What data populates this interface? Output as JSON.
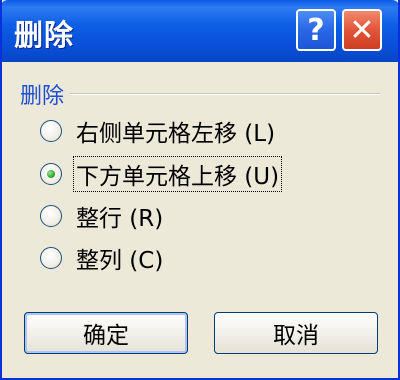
{
  "window": {
    "title": "删除",
    "help_label": "?",
    "close_label": "✕"
  },
  "group": {
    "label": "删除"
  },
  "options": [
    {
      "label": "右侧单元格左移 (L)",
      "selected": false
    },
    {
      "label": "下方单元格上移 (U)",
      "selected": true
    },
    {
      "label": "整行 (R)",
      "selected": false
    },
    {
      "label": "整列 (C)",
      "selected": false
    }
  ],
  "buttons": {
    "ok_label": "确定",
    "cancel_label": "取消"
  },
  "colors": {
    "titlebar": "#0a5ae8",
    "dialog_bg": "#ece9d8",
    "group_label": "#1f4ed0",
    "close_button": "#e2553a",
    "radio_dot": "#21a121"
  }
}
